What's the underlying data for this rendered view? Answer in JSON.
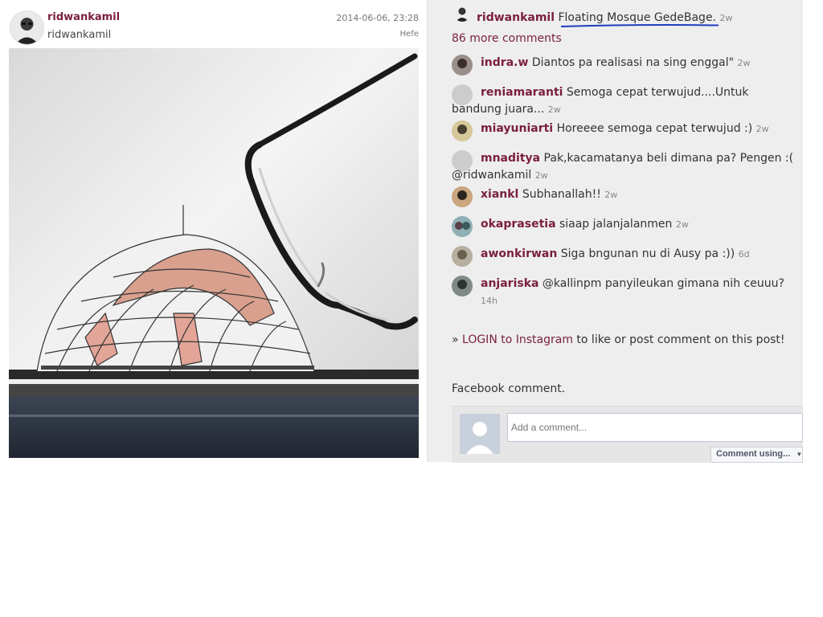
{
  "post": {
    "username": "ridwankamil",
    "subname": "ridwankamil",
    "date": "2014-06-06, 23:28",
    "filter": "Hefe",
    "photo_icon": "mosque-sketch-with-glasses-photo"
  },
  "caption": {
    "username": "ridwankamil",
    "text": "Floating Mosque GedeBage.",
    "ago": "2w",
    "underline_color": "#1f3fbf"
  },
  "more_comments": "86 more comments",
  "comments": [
    {
      "user": "indra.w",
      "text": "Diantos pa realisasi na sing enggal\"",
      "ago": "2w"
    },
    {
      "user": "reniamaranti",
      "text": "Semoga cepat terwujud....Untuk bandung juara...",
      "ago": "2w"
    },
    {
      "user": "miayuniarti",
      "text": "Horeeee semoga cepat terwujud :)",
      "ago": "2w"
    },
    {
      "user": "mnaditya",
      "text": "Pak,kacamatanya beli dimana pa? Pengen :( @ridwankamil",
      "ago": "2w"
    },
    {
      "user": "xiankl",
      "text": "Subhanallah!!",
      "ago": "2w"
    },
    {
      "user": "okaprasetia",
      "text": "siaap jalanjalanmen",
      "ago": "2w"
    },
    {
      "user": "awonkirwan",
      "text": "Siga bngunan nu di Ausy pa :))",
      "ago": "6d"
    },
    {
      "user": "anjariska",
      "text": "@kallinpm panyileukan gimana nih ceuuu?",
      "ago": "14h"
    }
  ],
  "login": {
    "prefix": "» ",
    "link": "LOGIN to Instagram",
    "suffix": " to like or post comment on this post!"
  },
  "facebook": {
    "label": "Facebook comment.",
    "placeholder": "Add a comment...",
    "button": "Comment using..."
  },
  "colors": {
    "username": "#7a1f3d",
    "panel_bg": "#eeeeee"
  }
}
